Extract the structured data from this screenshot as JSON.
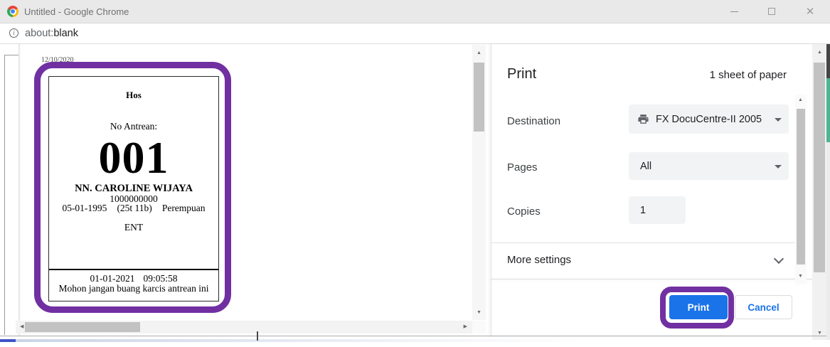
{
  "window": {
    "title": "Untitled - Google Chrome"
  },
  "address_bar": {
    "scheme": "about:",
    "path": "blank"
  },
  "preview": {
    "header_date": "12/10/2020",
    "ticket": {
      "hospital": "Hos",
      "queue_label": "No Antrean:",
      "queue_number": "001",
      "patient_name": "NN. CAROLINE WIJAYA",
      "patient_id": "1000000000",
      "birth_date": "05-01-1995",
      "age": "(25t 11b)",
      "gender": "Perempuan",
      "department": "ENT",
      "print_date": "01-01-2021",
      "print_time": "09:05:58",
      "footer_note": "Mohon jangan buang karcis antrean ini"
    }
  },
  "dialog": {
    "title": "Print",
    "sheet_info": "1 sheet of paper",
    "destination": {
      "label": "Destination",
      "value": "FX DocuCentre-II 2005"
    },
    "pages": {
      "label": "Pages",
      "value": "All"
    },
    "copies": {
      "label": "Copies",
      "value": "1"
    },
    "more_settings": {
      "label": "More settings"
    },
    "print_button": "Print",
    "cancel_button": "Cancel"
  },
  "colors": {
    "accent_blue": "#1A73E8",
    "highlight_purple": "#7130A2",
    "select_gray": "#F2F3F4",
    "sliver_teal": "#50B492"
  }
}
